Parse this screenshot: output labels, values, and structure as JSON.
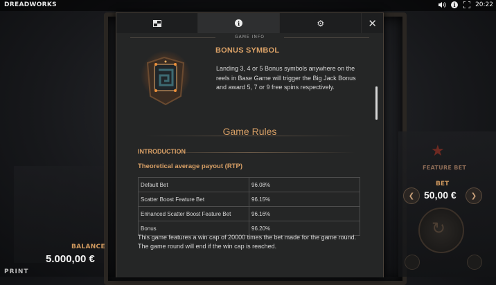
{
  "app": {
    "title": "DREADWORKS",
    "clock": "20:22"
  },
  "topbar_icons": [
    "volume-icon",
    "info-icon",
    "fullscreen-icon"
  ],
  "tabs": [
    {
      "icon": "paytable-icon",
      "active": false
    },
    {
      "icon": "info-icon",
      "active": true
    },
    {
      "icon": "settings-icon",
      "active": false
    }
  ],
  "modal": {
    "section_title": "GAME INFO",
    "bonus": {
      "title": "BONUS SYMBOL",
      "text": "Landing 3, 4 or 5 Bonus symbols anywhere on the reels in Base Game will trigger the Big Jack Bonus and award 5, 7 or 9 free spins respectively."
    },
    "rules_title": "Game Rules",
    "intro_heading": "INTRODUCTION",
    "rtp_heading": "Theoretical average payout (RTP)",
    "rtp_table": [
      {
        "label": "Default Bet",
        "value": "96.08%"
      },
      {
        "label": "Scatter Boost Feature Bet",
        "value": "96.15%"
      },
      {
        "label": "Enhanced Scatter Boost Feature Bet",
        "value": "96.16%"
      },
      {
        "label": "Bonus",
        "value": "96.20%"
      }
    ],
    "wincap_text": "This game features a win cap of 20000 times the bet made for the game round. The game round will end if the win cap is reached."
  },
  "balance": {
    "label": "BALANCE",
    "value": "5.000,00 €"
  },
  "bet": {
    "feature_label": "FEATURE BET",
    "label": "BET",
    "value": "50,00 €"
  },
  "footer": {
    "logo": "PRINT"
  },
  "colors": {
    "accent": "#d9a066",
    "panel": "#252626",
    "tabbar": "#1d1e1f"
  }
}
